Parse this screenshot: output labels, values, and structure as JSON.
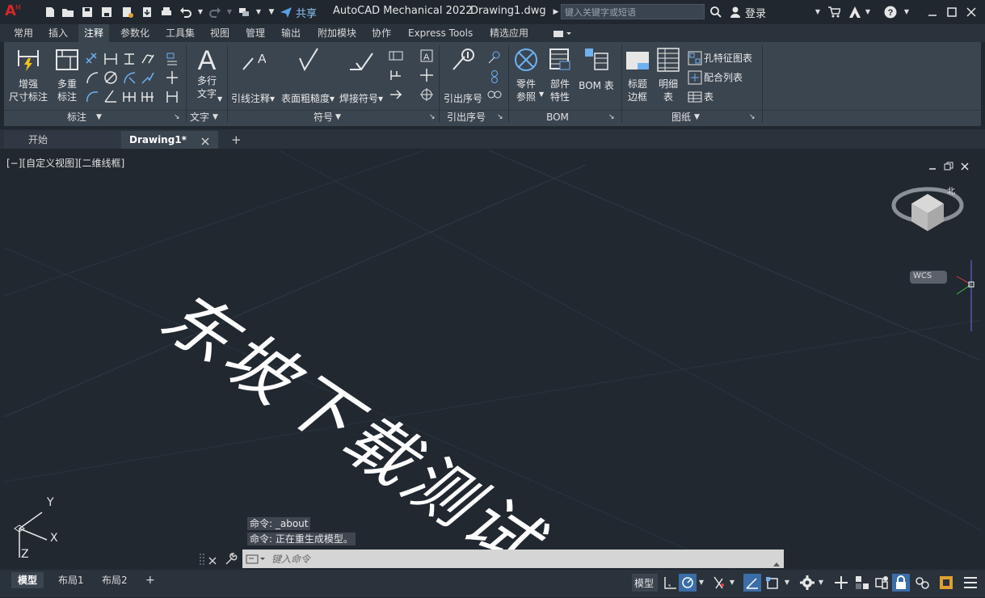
{
  "titlebar": {
    "app_title": "AutoCAD Mechanical 2022",
    "file_title": "Drawing1.dwg",
    "share_label": "共享",
    "search_placeholder": "键入关键字或短语",
    "login_label": "登录",
    "logo_letter": "A",
    "logo_sub": "M"
  },
  "ribbon_tabs": [
    "常用",
    "插入",
    "注释",
    "参数化",
    "工具集",
    "视图",
    "管理",
    "输出",
    "附加模块",
    "协作",
    "Express Tools",
    "精选应用"
  ],
  "active_tab": "注释",
  "ribbon": {
    "dim_enhanced": "增强",
    "dim_enhanced2": "尺寸标注",
    "dim_multi": "多重",
    "dim_multi2": "标注",
    "text_multi": "多行",
    "text_multi2": "文字",
    "leader_note": "引线注释",
    "surface_rough": "表面粗糙度",
    "weld_symbol": "焊接符号",
    "balloon": "引出序号",
    "part_ref": "零件",
    "part_ref2": "参照",
    "part_props": "部件",
    "part_props2": "特性",
    "bom_table": "BOM 表",
    "title_border": "标题",
    "title_border2": "边框",
    "parts_list": "明细",
    "parts_list2": "表",
    "hole_chart": "孔特征图表",
    "fits_list": "配合列表",
    "table": "表",
    "text_A": "A",
    "panels": {
      "dimension": "标注",
      "text": "文字",
      "symbol": "符号",
      "balloon": "引出序号",
      "bom": "BOM",
      "drawing": "图纸"
    }
  },
  "doc_tabs": {
    "start": "开始",
    "drawing": "Drawing1*",
    "add": "+"
  },
  "viewport": {
    "label": "[−][自定义视图][二维线框]",
    "big_text": "东坡下载测试",
    "wcs_label": "WCS",
    "viewcube_label": "北",
    "axis_x": "X",
    "axis_y": "Y",
    "axis_z": "Z"
  },
  "command": {
    "history1": "命令: _about",
    "history2": "命令:  正在重生成模型。",
    "placeholder": "键入命令"
  },
  "layout_tabs": [
    "模型",
    "布局1",
    "布局2"
  ],
  "status": {
    "model_label": "模型"
  },
  "colors": {
    "accent": "#3b6ea8",
    "logo_red": "#d7262a",
    "background": "#212830"
  }
}
